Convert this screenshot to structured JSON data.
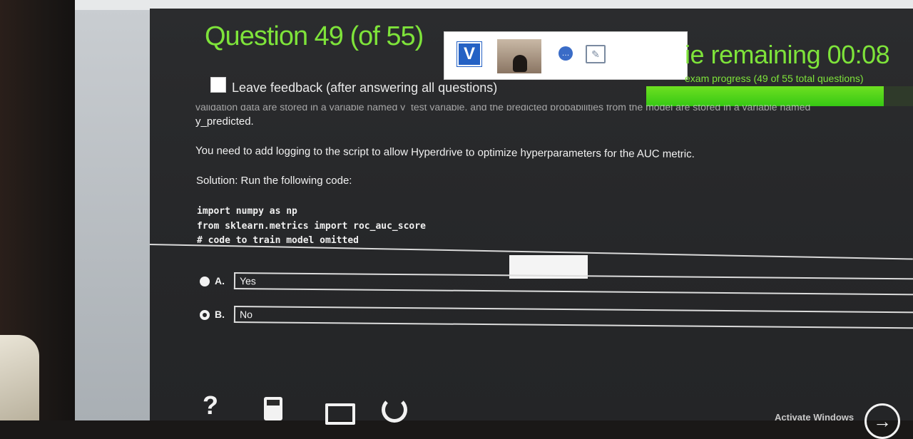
{
  "header": {
    "question_title": "Question 49 (of 55)",
    "time_remaining": "ie remaining  00:08",
    "exam_progress_label": "exam progress (49 of 55 total questions)",
    "progress_fraction": 0.89,
    "accent_color": "#7ee33a"
  },
  "proctor_overlay": {
    "logo_letter": "V"
  },
  "feedback": {
    "label": "Leave feedback (after answering all questions)"
  },
  "question": {
    "truncated_line": "validation data are stored in a variable named y_test variable, and the predicted probabilities from the model are stored in a variable named",
    "line1": "y_predicted.",
    "line2": "You need to add logging to the script to allow Hyperdrive to optimize hyperparameters for the AUC metric.",
    "line3": "Solution: Run the following code:",
    "code": [
      "import numpy as np",
      "from sklearn.metrics import roc_auc_score",
      "# code to train model omitted"
    ]
  },
  "answers": [
    {
      "letter": "A.",
      "text": "Yes",
      "selected": false
    },
    {
      "letter": "B.",
      "text": "No",
      "selected": true
    }
  ],
  "toolbar": {
    "help_glyph": "?",
    "activate_text": "Activate Windows",
    "next_glyph": "→"
  }
}
